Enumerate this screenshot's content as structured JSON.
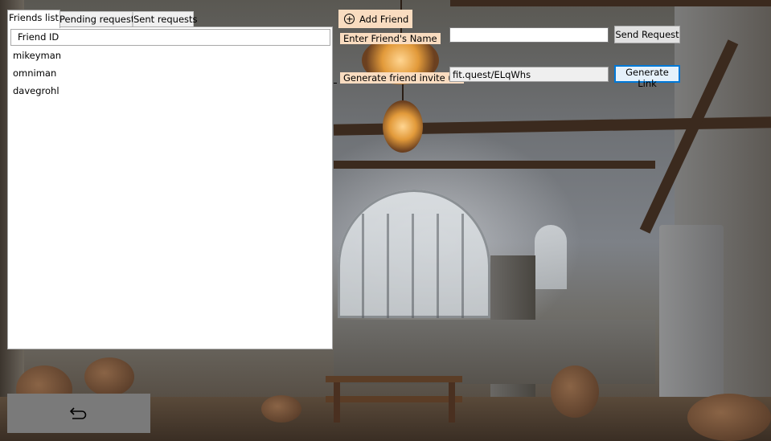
{
  "tabs": [
    {
      "label": "Friends list",
      "active": true
    },
    {
      "label": "Pending requests",
      "active": false
    },
    {
      "label": "Sent requests",
      "active": false
    }
  ],
  "friends_list": {
    "column_header": "Friend ID",
    "rows": [
      "mikeyman",
      "omniman",
      "davegrohl"
    ]
  },
  "add_friend": {
    "title": "Add Friend",
    "name_label": "Enter Friend's Name",
    "name_value": "",
    "send_button": "Send Request",
    "invite_label": "Generate friend invite url",
    "invite_value": "fit.quest/ELqWhs",
    "generate_button": "Generate Link"
  },
  "back_button": {
    "icon": "return-arrow-icon"
  },
  "colors": {
    "label_bg": "#f9dcc0",
    "back_button_bg": "#7a7a7a",
    "focus_border": "#0078d7"
  }
}
